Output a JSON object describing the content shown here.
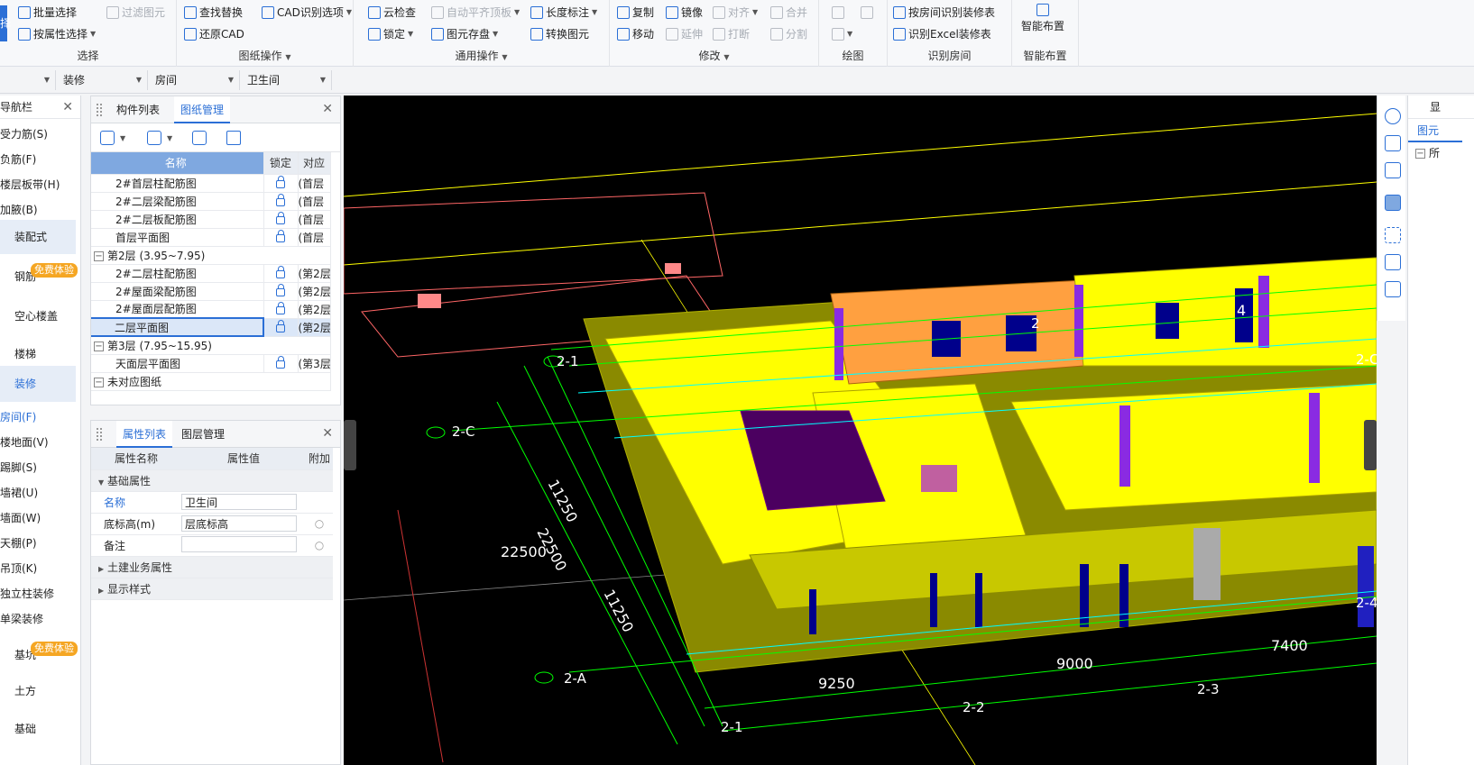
{
  "ribbon": {
    "select_group": {
      "label": "选择",
      "b1": "批量选择",
      "b2": "按属性选择",
      "b3": "过滤图元",
      "cut_label": "择"
    },
    "drawing_group": {
      "label": "图纸操作",
      "b1": "查找替换",
      "b2": "CAD识别选项",
      "b3": "还原CAD"
    },
    "general_group": {
      "label": "通用操作",
      "b1": "云检查",
      "b2": "自动平齐顶板",
      "b3": "长度标注",
      "b4": "锁定",
      "b5": "图元存盘",
      "b6": "转换图元"
    },
    "modify_group": {
      "label": "修改",
      "b1": "复制",
      "b2": "镜像",
      "b3": "对齐",
      "b4": "合并",
      "b5": "移动",
      "b6": "延伸",
      "b7": "打断",
      "b8": "分割"
    },
    "draw_group": {
      "label": "绘图"
    },
    "room_group": {
      "label": "识别房间",
      "b1": "按房间识别装修表",
      "b2": "识别Excel装修表"
    },
    "smart_group": {
      "label": "智能布置",
      "b1": "智能布置"
    }
  },
  "selectors": [
    "",
    "装修",
    "房间",
    "卫生间"
  ],
  "nav": {
    "title": "导航栏",
    "items": [
      "受力筋(S)",
      "负筋(F)",
      "楼层板带(H)",
      "加腋(B)",
      "装配式",
      "钢筋",
      "空心楼盖",
      "楼梯",
      "装修",
      "房间(F)",
      "楼地面(V)",
      "踢脚(S)",
      "墙裙(U)",
      "墙面(W)",
      "天棚(P)",
      "吊顶(K)",
      "独立柱装修",
      "单梁装修",
      "基坑",
      "土方",
      "基础"
    ],
    "badge": "免费体验"
  },
  "drawing_panel": {
    "tab1": "构件列表",
    "tab2": "图纸管理",
    "headers": [
      "名称",
      "锁定",
      "对应"
    ],
    "rows": [
      {
        "name": "2#首层柱配筋图",
        "lock": true,
        "target": "(首层"
      },
      {
        "name": "2#二层梁配筋图",
        "lock": true,
        "target": "(首层"
      },
      {
        "name": "2#二层板配筋图",
        "lock": true,
        "target": "(首层"
      },
      {
        "name": "首层平面图",
        "lock": true,
        "target": "(首层"
      },
      {
        "name": "第2层 (3.95~7.95)",
        "group": true
      },
      {
        "name": "2#二层柱配筋图",
        "lock": true,
        "target": "(第2层"
      },
      {
        "name": "2#屋面梁配筋图",
        "lock": true,
        "target": "(第2层"
      },
      {
        "name": "2#屋面层配筋图",
        "lock": true,
        "target": "(第2层"
      },
      {
        "name": "二层平面图",
        "lock": true,
        "target": "(第2层",
        "selected": true
      },
      {
        "name": "第3层 (7.95~15.95)",
        "group": true
      },
      {
        "name": "天面层平面图",
        "lock": true,
        "target": "(第3层"
      },
      {
        "name": "未对应图纸",
        "group": true
      }
    ]
  },
  "prop_panel": {
    "tab1": "属性列表",
    "tab2": "图层管理",
    "headers": [
      "属性名称",
      "属性值",
      "附加"
    ],
    "base_group": "基础属性",
    "rows": [
      {
        "name": "名称",
        "value": "卫生间",
        "blue": true
      },
      {
        "name": "底标高(m)",
        "value": "层底标高"
      },
      {
        "name": "备注",
        "value": ""
      }
    ],
    "group2": "土建业务属性",
    "group3": "显示样式"
  },
  "canvas": {
    "dims": [
      "11250",
      "22500",
      "11250",
      "22500",
      "9250",
      "9000",
      "7400"
    ],
    "axes": [
      "2-1",
      "2-C",
      "2-A",
      "2-1",
      "2-2",
      "2-3",
      "2-4",
      "2-C",
      "4",
      "2"
    ]
  },
  "right_panel": {
    "title": "显",
    "tab": "图元",
    "item": "所"
  }
}
